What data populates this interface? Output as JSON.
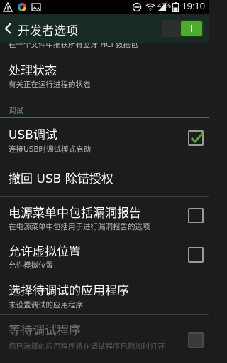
{
  "status_bar": {
    "battery": "47%",
    "time": "19:10",
    "icons": [
      "warning-icon",
      "color-circle-icon",
      "image-icon",
      "no-entry-icon",
      "wifi-icon",
      "signal-icon",
      "battery-icon"
    ]
  },
  "header": {
    "title": "开发者选项",
    "master_switch_on": true
  },
  "items": [
    {
      "title": "",
      "subtitle": "在一个文件中捕获所有蓝牙 HCI 数据包"
    },
    {
      "title": "处理状态",
      "subtitle": "有关正在运行进程的状态"
    },
    {
      "section": "调试"
    },
    {
      "title": "USB调试",
      "subtitle": "连接USB时调试模式启动",
      "checked": true
    },
    {
      "title": "撤回 USB 除错授权"
    },
    {
      "title": "电源菜单中包括漏洞报告",
      "subtitle": "在电源菜单中包括用于进行漏洞报告的选项",
      "checked": false
    },
    {
      "title": "允许虚拟位置",
      "subtitle": "允许模拟位置",
      "checked": false
    },
    {
      "title": "选择待调试的应用程序",
      "subtitle": "未设置调试的应用程序"
    },
    {
      "title": "等待调试程序",
      "subtitle": "您已选择的应用程序将在调试程序已附加时打开",
      "checked": false,
      "disabled": true
    }
  ],
  "colors": {
    "accent_green": "#4caf26",
    "section_header": "#6e8f88",
    "action_bar": "#182a25",
    "background": "#1c1c1c"
  }
}
